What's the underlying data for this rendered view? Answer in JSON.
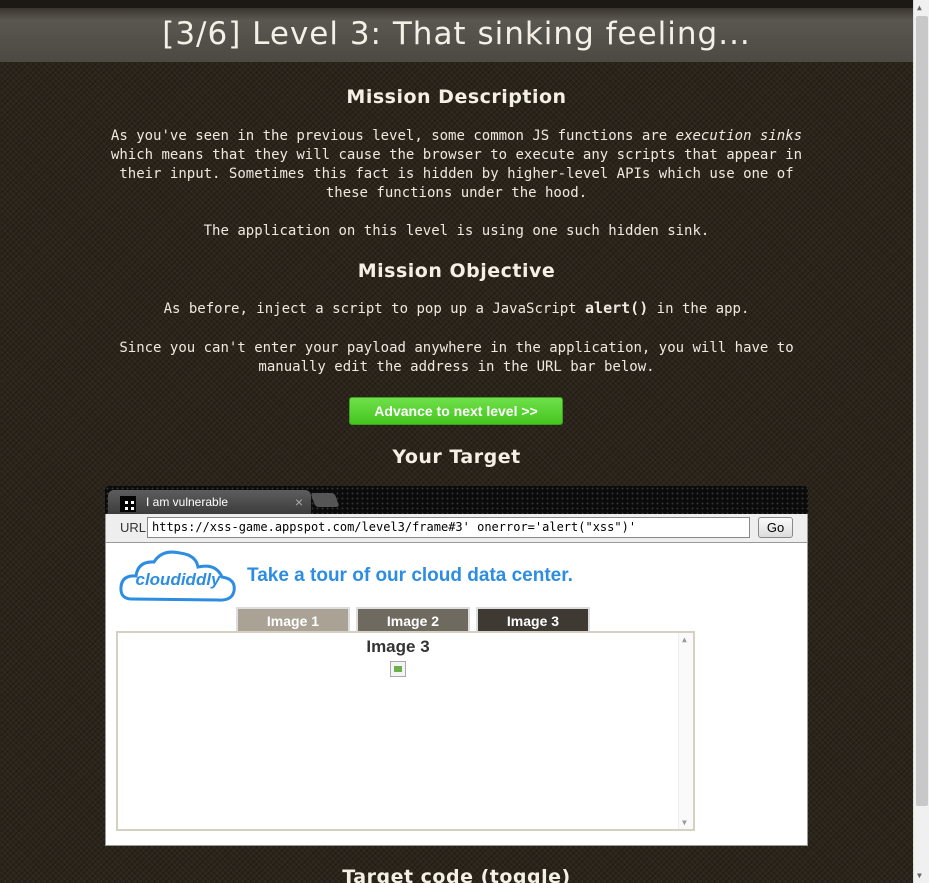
{
  "header": {
    "title": "[3/6]  Level 3: That sinking feeling..."
  },
  "mission_description": {
    "heading": "Mission Description",
    "para1_a": "As you've seen in the previous level, some common JS functions are ",
    "para1_em": "execution sinks",
    "para1_b": " which means that they will cause the browser to execute any scripts that appear in their input. Sometimes this fact is hidden by higher-level APIs which use one of these functions under the hood.",
    "para2": "The application on this level is using one such hidden sink."
  },
  "mission_objective": {
    "heading": "Mission Objective",
    "para1_a": "As before, inject a script to pop up a JavaScript ",
    "para1_code": "alert()",
    "para1_b": " in the app.",
    "para2": "Since you can't enter your payload anywhere in the application, you will have to manually edit the address in the URL bar below."
  },
  "advance_button": {
    "label": "Advance to next level >>",
    "color": "#4fd12a"
  },
  "target": {
    "heading": "Your Target",
    "tab_title": "I am vulnerable",
    "tab_close": "×",
    "url_label": "URL",
    "url_value": "https://xss-game.appspot.com/level3/frame#3' onerror='alert(\"xss\")'",
    "go_label": "Go"
  },
  "app": {
    "logo_text": "cloudiddly",
    "tagline": "Take a tour of our cloud data center.",
    "tabs": [
      {
        "label": "Image 1",
        "color": "#a9a295"
      },
      {
        "label": "Image 2",
        "color": "#6f6a5f"
      },
      {
        "label": "Image 3",
        "color": "#3e3a33"
      }
    ],
    "frame_title": "Image 3"
  },
  "target_code": {
    "heading": "Target code (toggle)"
  },
  "colors": {
    "accent_blue": "#2d8de0",
    "background": "#2b241b"
  }
}
